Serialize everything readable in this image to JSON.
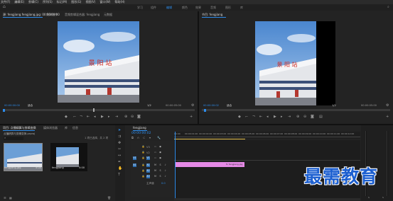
{
  "menu": [
    "文件(F)",
    "编辑(E)",
    "剪辑(C)",
    "序列(S)",
    "标记(M)",
    "图形(G)",
    "视图(V)",
    "窗口(W)",
    "帮助(H)"
  ],
  "workspaces": [
    "学习",
    "组件",
    "编辑",
    "颜色",
    "效果",
    "音频",
    "图形",
    "库"
  ],
  "source_panel": {
    "tabs": [
      "源: fengjiang.fengjiang.jpg: 00:00:00:00",
      "效果控件",
      "音频剪辑混合器: fengjiang",
      "元数据"
    ],
    "timecode_left": "00:00:00:00",
    "fit": "适合",
    "ratio": "1/2",
    "timecode_right": "00:00:05:00"
  },
  "program_panel": {
    "tabs": [
      "节目: fengjiang"
    ],
    "timecode_left": "00:00:00:02",
    "fit": "适合",
    "ratio": "1/2",
    "timecode_right": "00:00:05:00"
  },
  "project_panel": {
    "tabs": [
      "项目: 点播精算与剪辑变换",
      "媒体浏览器",
      "库",
      "信息"
    ],
    "project_file": "点播精算与剪辑变换.prproj",
    "item_count": "1 项已选择，共 2 项",
    "items": [
      {
        "name": "fengjiang.jpg",
        "duration": "5:00"
      },
      {
        "name": "fengjiang",
        "duration": "5:00"
      }
    ]
  },
  "timeline": {
    "tab": "fengjiang",
    "timecode": "00:00:00:02",
    "ruler": [
      "00:00",
      "00:00:01:00",
      "00:00:02:00",
      "00:00:03:00",
      "00:00:04:00",
      "00:00:05:00",
      "00:00:06:00",
      "00:00:07:00",
      "00:00:08:00",
      "00:00:09:00",
      "00:00:10:00",
      "00:00:11:00",
      "00:00:12:00"
    ],
    "video_tracks": [
      "V3",
      "V2",
      "V1"
    ],
    "audio_tracks": [
      "A1",
      "A2",
      "A3"
    ],
    "master": "主声道",
    "master_value": "0.0",
    "clip_label": "fx fengjiang.jpg"
  },
  "photo_sign": "景 阳 站",
  "watermark": "最需教育",
  "colors": {
    "accent": "#2d8ceb",
    "clip": "#e58ae6",
    "sky": "#6c9fd6"
  }
}
